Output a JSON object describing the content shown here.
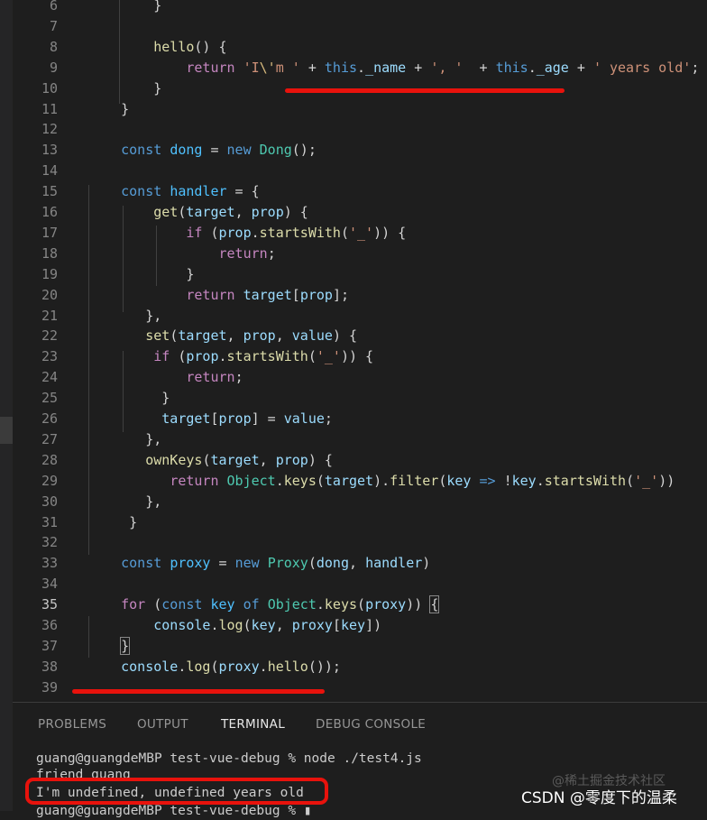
{
  "editor": {
    "lines": [
      {
        "n": "6",
        "t": [
          [
            "p",
            "        }"
          ]
        ]
      },
      {
        "n": "7",
        "t": []
      },
      {
        "n": "8",
        "t": [
          [
            "p",
            "        "
          ],
          [
            "fn",
            "hello"
          ],
          [
            "p",
            "() {"
          ]
        ]
      },
      {
        "n": "9",
        "t": [
          [
            "p",
            "            "
          ],
          [
            "ctl",
            "return"
          ],
          [
            "p",
            " "
          ],
          [
            "str",
            "'I"
          ],
          [
            "esc",
            "\\'"
          ],
          [
            "str",
            "m '"
          ],
          [
            "p",
            " + "
          ],
          [
            "kw",
            "this"
          ],
          [
            "p",
            "."
          ],
          [
            "var",
            "_name"
          ],
          [
            "p",
            " + "
          ],
          [
            "str",
            "', '"
          ],
          [
            "p",
            "  + "
          ],
          [
            "kw",
            "this"
          ],
          [
            "p",
            "."
          ],
          [
            "var",
            "_age"
          ],
          [
            "p",
            " + "
          ],
          [
            "str",
            "' years old'"
          ],
          [
            "p",
            ";"
          ]
        ]
      },
      {
        "n": "10",
        "t": [
          [
            "p",
            "        }"
          ]
        ]
      },
      {
        "n": "11",
        "t": [
          [
            "p",
            "    }"
          ]
        ]
      },
      {
        "n": "12",
        "t": []
      },
      {
        "n": "13",
        "t": [
          [
            "p",
            "    "
          ],
          [
            "kw",
            "const"
          ],
          [
            "p",
            " "
          ],
          [
            "const",
            "dong"
          ],
          [
            "p",
            " = "
          ],
          [
            "kw",
            "new"
          ],
          [
            "p",
            " "
          ],
          [
            "cls",
            "Dong"
          ],
          [
            "p",
            "();"
          ]
        ]
      },
      {
        "n": "14",
        "t": []
      },
      {
        "n": "15",
        "t": [
          [
            "p",
            "    "
          ],
          [
            "kw",
            "const"
          ],
          [
            "p",
            " "
          ],
          [
            "const",
            "handler"
          ],
          [
            "p",
            " = {"
          ]
        ]
      },
      {
        "n": "16",
        "t": [
          [
            "p",
            "        "
          ],
          [
            "fn",
            "get"
          ],
          [
            "p",
            "("
          ],
          [
            "var",
            "target"
          ],
          [
            "p",
            ", "
          ],
          [
            "var",
            "prop"
          ],
          [
            "p",
            ") {"
          ]
        ]
      },
      {
        "n": "17",
        "t": [
          [
            "p",
            "            "
          ],
          [
            "ctl",
            "if"
          ],
          [
            "p",
            " ("
          ],
          [
            "var",
            "prop"
          ],
          [
            "p",
            "."
          ],
          [
            "fn",
            "startsWith"
          ],
          [
            "p",
            "("
          ],
          [
            "str",
            "'_'"
          ],
          [
            "p",
            ")) {"
          ]
        ]
      },
      {
        "n": "18",
        "t": [
          [
            "p",
            "                "
          ],
          [
            "ctl",
            "return"
          ],
          [
            "p",
            ";"
          ]
        ]
      },
      {
        "n": "19",
        "t": [
          [
            "p",
            "            }"
          ]
        ]
      },
      {
        "n": "20",
        "t": [
          [
            "p",
            "            "
          ],
          [
            "ctl",
            "return"
          ],
          [
            "p",
            " "
          ],
          [
            "var",
            "target"
          ],
          [
            "p",
            "["
          ],
          [
            "var",
            "prop"
          ],
          [
            "p",
            "];"
          ]
        ]
      },
      {
        "n": "21",
        "t": [
          [
            "p",
            "       },"
          ]
        ]
      },
      {
        "n": "22",
        "t": [
          [
            "p",
            "       "
          ],
          [
            "fn",
            "set"
          ],
          [
            "p",
            "("
          ],
          [
            "var",
            "target"
          ],
          [
            "p",
            ", "
          ],
          [
            "var",
            "prop"
          ],
          [
            "p",
            ", "
          ],
          [
            "var",
            "value"
          ],
          [
            "p",
            ") {"
          ]
        ]
      },
      {
        "n": "23",
        "t": [
          [
            "p",
            "        "
          ],
          [
            "ctl",
            "if"
          ],
          [
            "p",
            " ("
          ],
          [
            "var",
            "prop"
          ],
          [
            "p",
            "."
          ],
          [
            "fn",
            "startsWith"
          ],
          [
            "p",
            "("
          ],
          [
            "str",
            "'_'"
          ],
          [
            "p",
            ")) {"
          ]
        ]
      },
      {
        "n": "24",
        "t": [
          [
            "p",
            "            "
          ],
          [
            "ctl",
            "return"
          ],
          [
            "p",
            ";"
          ]
        ]
      },
      {
        "n": "25",
        "t": [
          [
            "p",
            "         }"
          ]
        ]
      },
      {
        "n": "26",
        "t": [
          [
            "p",
            "         "
          ],
          [
            "var",
            "target"
          ],
          [
            "p",
            "["
          ],
          [
            "var",
            "prop"
          ],
          [
            "p",
            "] = "
          ],
          [
            "var",
            "value"
          ],
          [
            "p",
            ";"
          ]
        ]
      },
      {
        "n": "27",
        "t": [
          [
            "p",
            "       },"
          ]
        ]
      },
      {
        "n": "28",
        "t": [
          [
            "p",
            "       "
          ],
          [
            "fn",
            "ownKeys"
          ],
          [
            "p",
            "("
          ],
          [
            "var",
            "target"
          ],
          [
            "p",
            ", "
          ],
          [
            "var",
            "prop"
          ],
          [
            "p",
            ") {"
          ]
        ]
      },
      {
        "n": "29",
        "t": [
          [
            "p",
            "          "
          ],
          [
            "ctl",
            "return"
          ],
          [
            "p",
            " "
          ],
          [
            "cls",
            "Object"
          ],
          [
            "p",
            "."
          ],
          [
            "fn",
            "keys"
          ],
          [
            "p",
            "("
          ],
          [
            "var",
            "target"
          ],
          [
            "p",
            ")."
          ],
          [
            "fn",
            "filter"
          ],
          [
            "p",
            "("
          ],
          [
            "var",
            "key"
          ],
          [
            "p",
            " "
          ],
          [
            "kw",
            "=>"
          ],
          [
            "p",
            " !"
          ],
          [
            "var",
            "key"
          ],
          [
            "p",
            "."
          ],
          [
            "fn",
            "startsWith"
          ],
          [
            "p",
            "("
          ],
          [
            "str",
            "'_'"
          ],
          [
            "p",
            "))"
          ]
        ]
      },
      {
        "n": "30",
        "t": [
          [
            "p",
            "       },"
          ]
        ]
      },
      {
        "n": "31",
        "t": [
          [
            "p",
            "     }"
          ]
        ]
      },
      {
        "n": "32",
        "t": []
      },
      {
        "n": "33",
        "t": [
          [
            "p",
            "    "
          ],
          [
            "kw",
            "const"
          ],
          [
            "p",
            " "
          ],
          [
            "const",
            "proxy"
          ],
          [
            "p",
            " = "
          ],
          [
            "kw",
            "new"
          ],
          [
            "p",
            " "
          ],
          [
            "cls",
            "Proxy"
          ],
          [
            "p",
            "("
          ],
          [
            "var",
            "dong"
          ],
          [
            "p",
            ", "
          ],
          [
            "var",
            "handler"
          ],
          [
            "p",
            ")"
          ]
        ]
      },
      {
        "n": "34",
        "t": []
      },
      {
        "n": "35",
        "t": [
          [
            "p",
            "    "
          ],
          [
            "ctl",
            "for"
          ],
          [
            "p",
            " ("
          ],
          [
            "kw",
            "const"
          ],
          [
            "p",
            " "
          ],
          [
            "const",
            "key"
          ],
          [
            "p",
            " "
          ],
          [
            "kw",
            "of"
          ],
          [
            "p",
            " "
          ],
          [
            "cls",
            "Object"
          ],
          [
            "p",
            "."
          ],
          [
            "fn",
            "keys"
          ],
          [
            "p",
            "("
          ],
          [
            "var",
            "proxy"
          ],
          [
            "p",
            ")) "
          ],
          [
            "brk",
            "{"
          ]
        ]
      },
      {
        "n": "36",
        "t": [
          [
            "p",
            "        "
          ],
          [
            "var",
            "console"
          ],
          [
            "p",
            "."
          ],
          [
            "fn",
            "log"
          ],
          [
            "p",
            "("
          ],
          [
            "var",
            "key"
          ],
          [
            "p",
            ", "
          ],
          [
            "var",
            "proxy"
          ],
          [
            "p",
            "["
          ],
          [
            "var",
            "key"
          ],
          [
            "p",
            "])"
          ]
        ]
      },
      {
        "n": "37",
        "t": [
          [
            "p",
            "    "
          ],
          [
            "brk",
            "}"
          ]
        ]
      },
      {
        "n": "38",
        "t": [
          [
            "p",
            "    "
          ],
          [
            "var",
            "console"
          ],
          [
            "p",
            "."
          ],
          [
            "fn",
            "log"
          ],
          [
            "p",
            "("
          ],
          [
            "var",
            "proxy"
          ],
          [
            "p",
            "."
          ],
          [
            "fn",
            "hello"
          ],
          [
            "p",
            "());"
          ]
        ]
      },
      {
        "n": "39",
        "t": []
      }
    ],
    "active_line": "35"
  },
  "panel": {
    "tabs": [
      "PROBLEMS",
      "OUTPUT",
      "TERMINAL",
      "DEBUG CONSOLE"
    ],
    "active_tab": "TERMINAL"
  },
  "terminal": {
    "prompt_line": "guang@guangdeMBP test-vue-debug % node ./test4.js",
    "output1": "friend guang",
    "output2": "I'm undefined, undefined years old",
    "prompt_last": "guang@guangdeMBP test-vue-debug % ▮"
  },
  "watermark": {
    "site": "@稀土掘金技术社区",
    "blog": "CSDN @零度下的温柔"
  },
  "colors": {
    "background": "#1e1e1e",
    "keyword": "#569cd6",
    "control": "#c586c0",
    "function": "#dcdcaa",
    "variable": "#9cdcfe",
    "constant": "#4fc1ff",
    "class": "#4ec9b0",
    "string": "#ce9178",
    "annotation_red": "#e8120c"
  }
}
